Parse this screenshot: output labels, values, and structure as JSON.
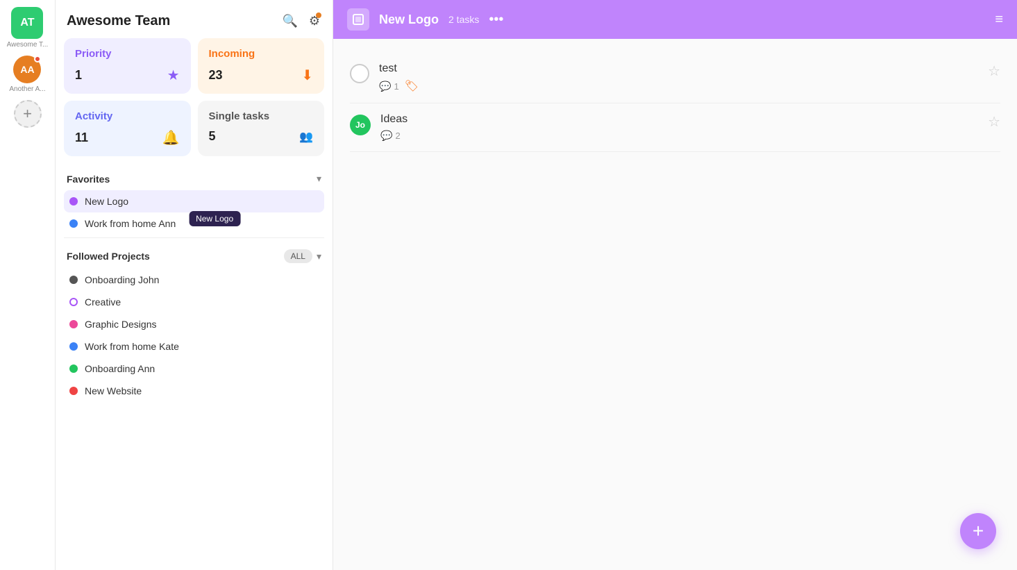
{
  "app_sidebar": {
    "team_initials": "AT",
    "team_label": "Awesome T...",
    "user_initials": "AA",
    "user_label": "Another A...",
    "add_label": "+"
  },
  "main_sidebar": {
    "title": "Awesome Team",
    "search_title": "Search",
    "settings_title": "Settings",
    "cards": [
      {
        "id": "priority",
        "label": "Priority",
        "value": "1",
        "icon": "★",
        "variant": "purple"
      },
      {
        "id": "incoming",
        "label": "Incoming",
        "value": "23",
        "icon": "⬇",
        "variant": "orange"
      },
      {
        "id": "activity",
        "label": "Activity",
        "value": "11",
        "icon": "🔔",
        "variant": "blue"
      },
      {
        "id": "single-tasks",
        "label": "Single tasks",
        "value": "5",
        "icon": "●●",
        "variant": "gray"
      }
    ],
    "favorites_label": "Favorites",
    "favorites_items": [
      {
        "id": "new-logo",
        "label": "New Logo",
        "color": "#a855f7",
        "active": true
      },
      {
        "id": "work-home-ann",
        "label": "Work from home Ann",
        "color": "#3b82f6",
        "active": false
      }
    ],
    "new_logo_tooltip": "New Logo",
    "followed_projects_label": "Followed Projects",
    "all_label": "ALL",
    "followed_items": [
      {
        "id": "onboarding-john",
        "label": "Onboarding John",
        "color": "#555"
      },
      {
        "id": "creative",
        "label": "Creative",
        "color": "#a855f7"
      },
      {
        "id": "graphic-designs",
        "label": "Graphic Designs",
        "color": "#ec4899"
      },
      {
        "id": "work-home-kate",
        "label": "Work from home Kate",
        "color": "#3b82f6"
      },
      {
        "id": "onboarding-ann",
        "label": "Onboarding Ann",
        "color": "#22c55e"
      },
      {
        "id": "new-website",
        "label": "New Website",
        "color": "#ef4444"
      }
    ]
  },
  "content_header": {
    "project_icon": "□",
    "title": "New Logo",
    "task_count_label": "2 tasks",
    "dots_label": "•••",
    "filter_icon": "≡"
  },
  "tasks": [
    {
      "id": "test",
      "title": "test",
      "avatar": null,
      "comments": "1",
      "has_tag": true,
      "tag_icon": "🏷"
    },
    {
      "id": "ideas",
      "title": "Ideas",
      "avatar_initials": "Jo",
      "avatar_color": "#22c55e",
      "comments": "2",
      "has_tag": false
    }
  ],
  "fab_label": "+"
}
